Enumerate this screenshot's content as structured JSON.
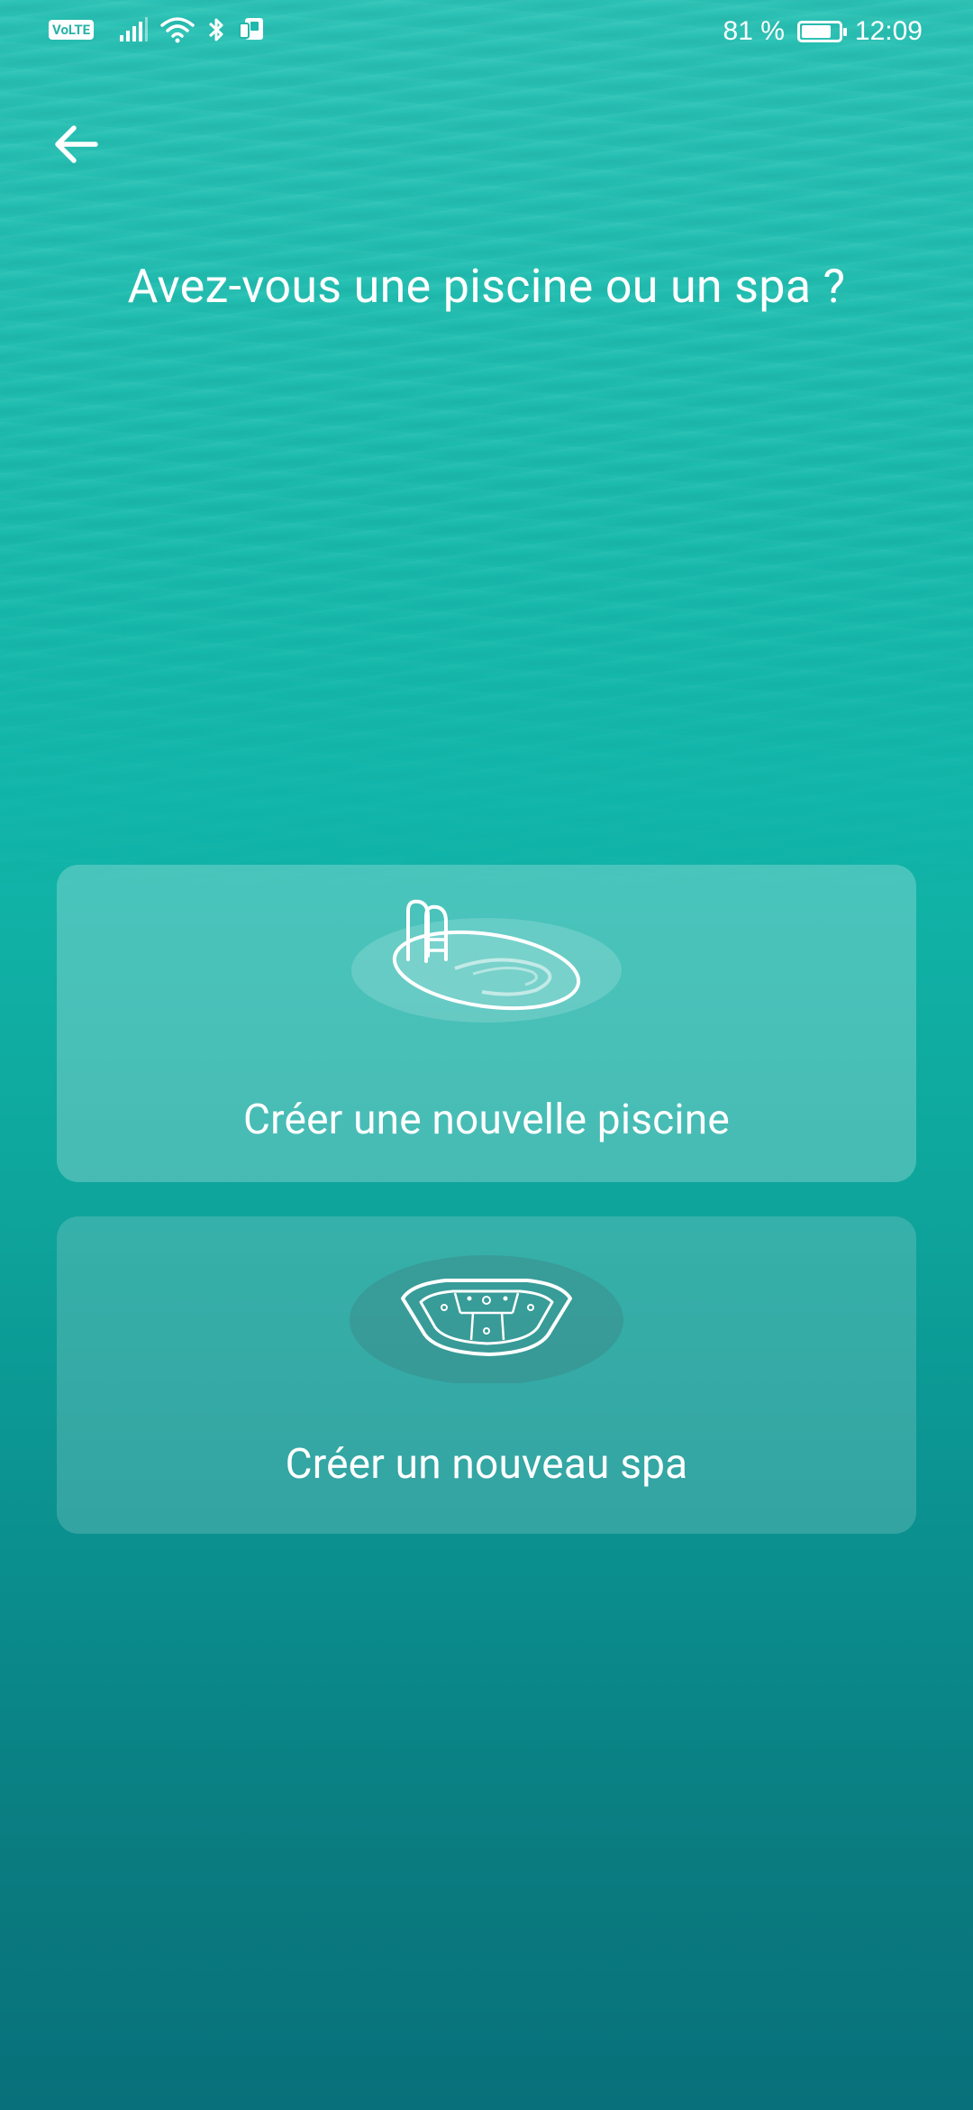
{
  "status_bar": {
    "volte": "VoLTE",
    "battery_percent": "81 %",
    "battery_level": 0.81,
    "time": "12:09",
    "icons": [
      "volte-icon",
      "signal-icon",
      "wifi-icon",
      "bluetooth-icon",
      "nfc-icon",
      "battery-icon"
    ]
  },
  "header": {
    "back_icon": "arrow-left-icon",
    "question": "Avez-vous une piscine ou un spa ?"
  },
  "options": [
    {
      "icon": "swimming-pool-icon",
      "label": "Créer une nouvelle piscine"
    },
    {
      "icon": "spa-hot-tub-icon",
      "label": "Créer un nouveau spa"
    }
  ],
  "colors": {
    "background_top": "#2cc3b6",
    "background_bottom": "#08707a",
    "text": "#ffffff"
  }
}
